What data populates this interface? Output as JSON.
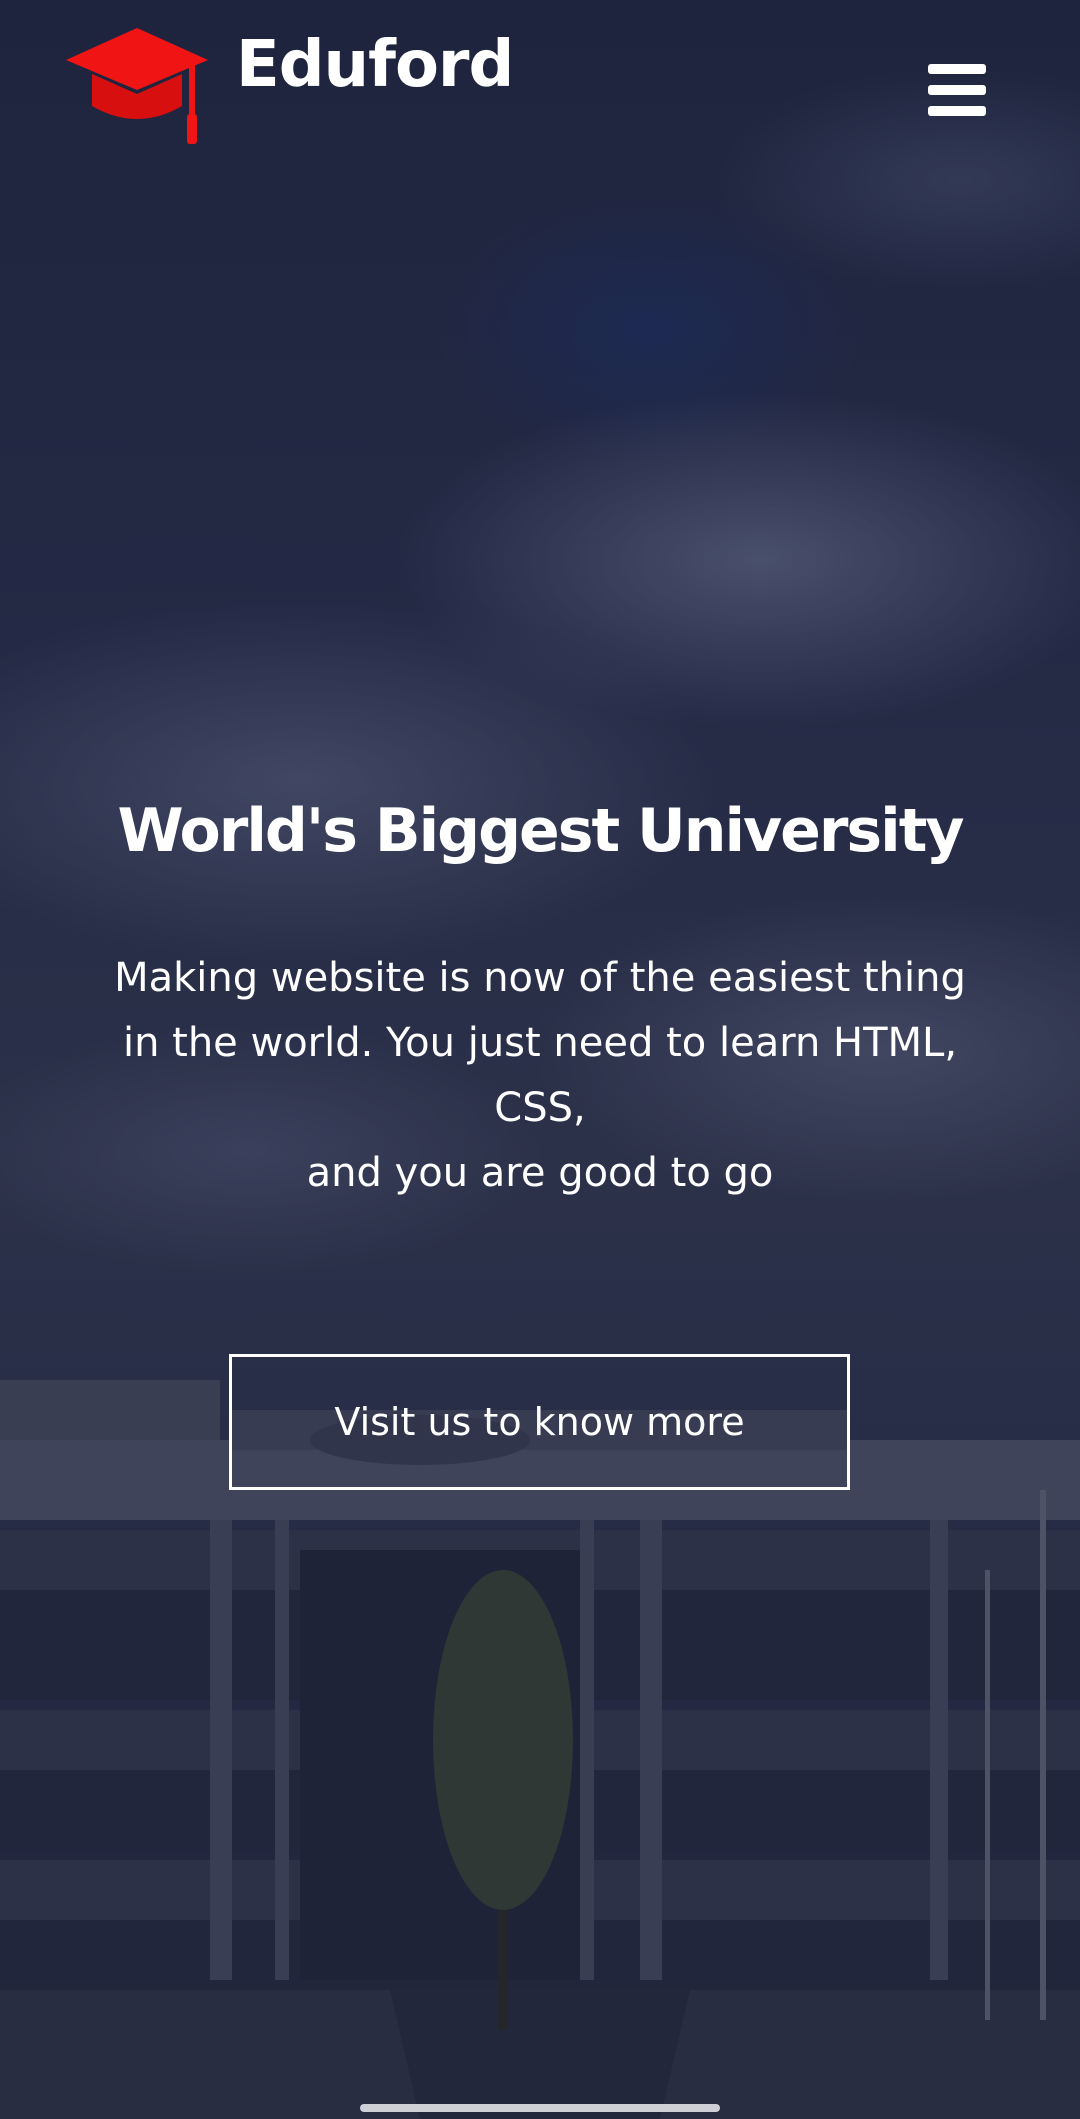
{
  "header": {
    "brand_name": "Eduford",
    "logo_icon": "graduation-cap-icon",
    "menu_icon": "hamburger-menu-icon"
  },
  "hero": {
    "title": "World's Biggest University",
    "description_lines": [
      "Making website is now of the easiest thing",
      "in the world. You just need to learn HTML,",
      "CSS,",
      "and you are good to go"
    ],
    "cta_label": "Visit us to know more"
  },
  "colors": {
    "brand_accent": "#f01414",
    "text": "#ffffff",
    "overlay": "#141830"
  }
}
